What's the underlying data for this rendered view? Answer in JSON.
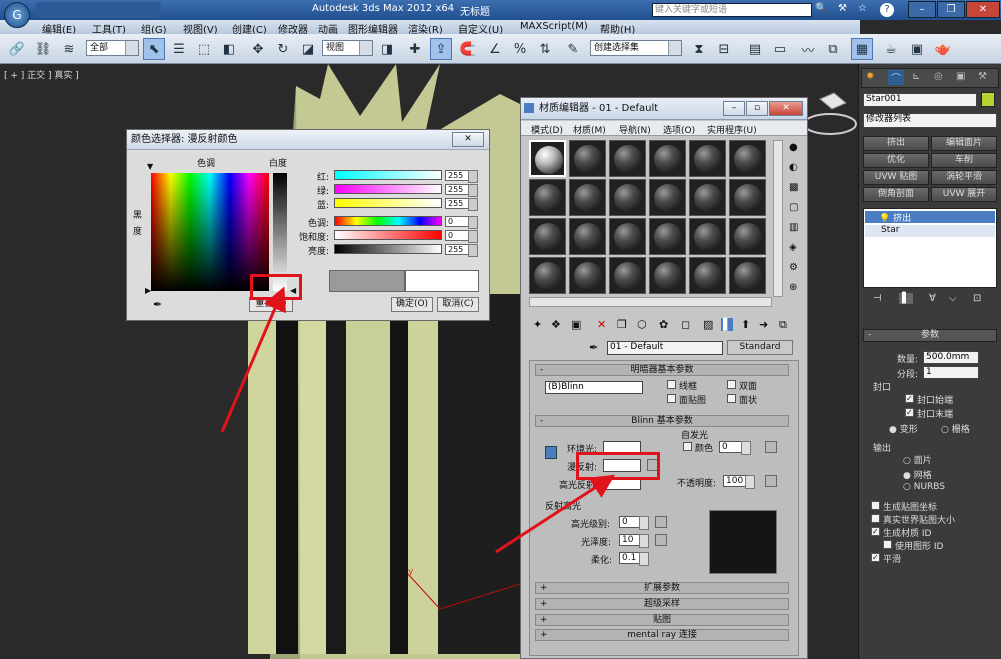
{
  "app": {
    "title": "Autodesk 3ds Max  2012 x64",
    "doc_title": "无标题",
    "search_placeholder": "键入关键字或短语"
  },
  "menu": [
    "编辑(E)",
    "工具(T)",
    "组(G)",
    "视图(V)",
    "创建(C)",
    "修改器",
    "动画",
    "图形编辑器",
    "渲染(R)",
    "自定义(U)",
    "MAXScript(M)",
    "帮助(H)"
  ],
  "toolbar": {
    "selection_filter": "全部",
    "ref_coord": "视图",
    "named_sel": "创建选择集"
  },
  "viewport": {
    "label": "[ + ] 正交 ] 真实 ]"
  },
  "command_panel": {
    "object_name": "Star001",
    "modifier_list": "修改器列表",
    "mod_buttons": [
      "挤出",
      "编辑面片",
      "优化",
      "车削",
      "UVW 贴图",
      "涡轮平滑",
      "倒角剖面",
      "UVW 展开"
    ],
    "stack": [
      "挤出",
      "Star"
    ],
    "params_title": "参数",
    "amount_label": "数量:",
    "amount_value": "500.0mm",
    "segments_label": "分段:",
    "segments_value": "1",
    "capping_label": "封口",
    "cap_start": "封口始端",
    "cap_end": "封口末端",
    "morph": "变形",
    "grid": "栅格",
    "output_label": "输出",
    "out_patch": "面片",
    "out_mesh": "网格",
    "out_nurbs": "NURBS",
    "gen_map": "生成贴图坐标",
    "real_world": "真实世界贴图大小",
    "gen_matid": "生成材质 ID",
    "use_shape_id": "使用图形 ID",
    "smooth": "平滑"
  },
  "material_editor": {
    "title": "材质编辑器 - 01 - Default",
    "menu": [
      "模式(D)",
      "材质(M)",
      "导航(N)",
      "选项(O)",
      "实用程序(U)"
    ],
    "material_name": "01 - Default",
    "material_type": "Standard",
    "shader_rollout": "明暗器基本参数",
    "shader": "(B)Blinn",
    "wire": "线框",
    "two_sided": "双面",
    "face_map": "面贴图",
    "faceted": "面状",
    "blinn_rollout": "Blinn 基本参数",
    "self_illum": "自发光",
    "color_label": "颜色",
    "color_value": "0",
    "ambient": "环境光:",
    "diffuse": "漫反射:",
    "specular": "高光反射:",
    "opacity_label": "不透明度:",
    "opacity_value": "100",
    "spec_highlights": "反射高光",
    "spec_level_label": "高光级别:",
    "spec_level_value": "0",
    "gloss_label": "光泽度:",
    "gloss_value": "10",
    "soften_label": "柔化:",
    "soften_value": "0.1",
    "rollouts": [
      "扩展参数",
      "超级采样",
      "贴图",
      "mental ray 连接"
    ]
  },
  "color_selector": {
    "title": "颜色选择器: 漫反射颜色",
    "hue_label": "色调",
    "white_label": "白度",
    "black_label": "黑度",
    "rows": [
      {
        "label": "红:",
        "value": "255"
      },
      {
        "label": "绿:",
        "value": "255"
      },
      {
        "label": "蓝:",
        "value": "255"
      },
      {
        "label": "色调:",
        "value": "0"
      },
      {
        "label": "饱和度:",
        "value": "0"
      },
      {
        "label": "亮度:",
        "value": "255"
      }
    ],
    "reset": "重置(R)",
    "ok": "确定(O)",
    "cancel": "取消(C)"
  },
  "colors": {
    "annotation_red": "#e0131a",
    "object_green": "#c9cf98",
    "title_blue": "#2a5c9c"
  }
}
